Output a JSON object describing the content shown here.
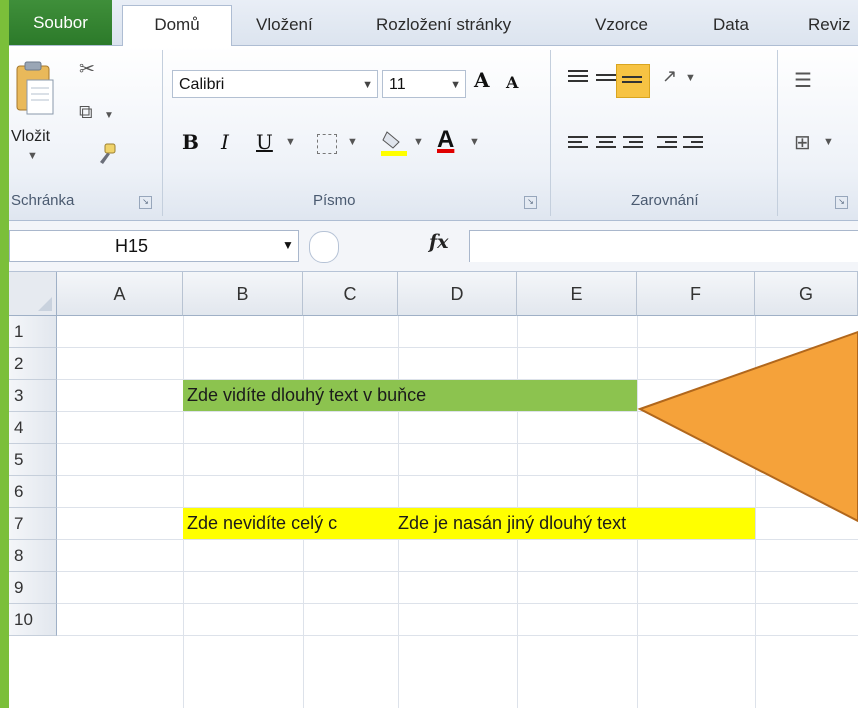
{
  "tabs": [
    "Soubor",
    "Domů",
    "Vložení",
    "Rozložení stránky",
    "Vzorce",
    "Data",
    "Reviz"
  ],
  "ribbon": {
    "paste_label": "Vložit",
    "groups": [
      "Schránka",
      "Písmo",
      "Zarovnání"
    ],
    "font_name": "Calibri",
    "font_size": "11",
    "grow_font": "A",
    "shrink_font": "A",
    "bold": "B",
    "italic": "I",
    "underline": "U",
    "font_color_glyph": "A"
  },
  "formula_bar": {
    "name_box": "H15",
    "fx": "fx"
  },
  "sheet": {
    "columns": [
      "A",
      "B",
      "C",
      "D",
      "E",
      "F",
      "G"
    ],
    "rows": [
      "1",
      "2",
      "3",
      "4",
      "5",
      "6",
      "7",
      "8",
      "9",
      "10"
    ],
    "cell_b3": "Zde vidíte dlouhý text v buňce",
    "cell_b7": "Zde nevidíte celý c",
    "cell_d7": "Zde je nasán jiný dlouhý text"
  },
  "colors": {
    "file_tab": "#2c7a2a",
    "b3_fill": "#8cc34f",
    "row7_fill": "#ffff00",
    "callout_fill": "#f5a23a",
    "callout_border": "#b1671c",
    "bg_green": "#5aa52a",
    "highlight_button": "#f7c343"
  },
  "icons": [
    "paste-icon",
    "cut-icon",
    "copy-icon",
    "format-painter-icon",
    "grow-font-icon",
    "shrink-font-icon",
    "border-icon",
    "fill-color-icon",
    "font-color-icon",
    "align-top-icon",
    "align-middle-icon",
    "align-bottom-icon",
    "orientation-icon",
    "align-left-icon",
    "align-center-icon",
    "align-right-icon",
    "decrease-indent-icon",
    "increase-indent-icon",
    "wrap-text-icon",
    "merge-center-icon"
  ]
}
